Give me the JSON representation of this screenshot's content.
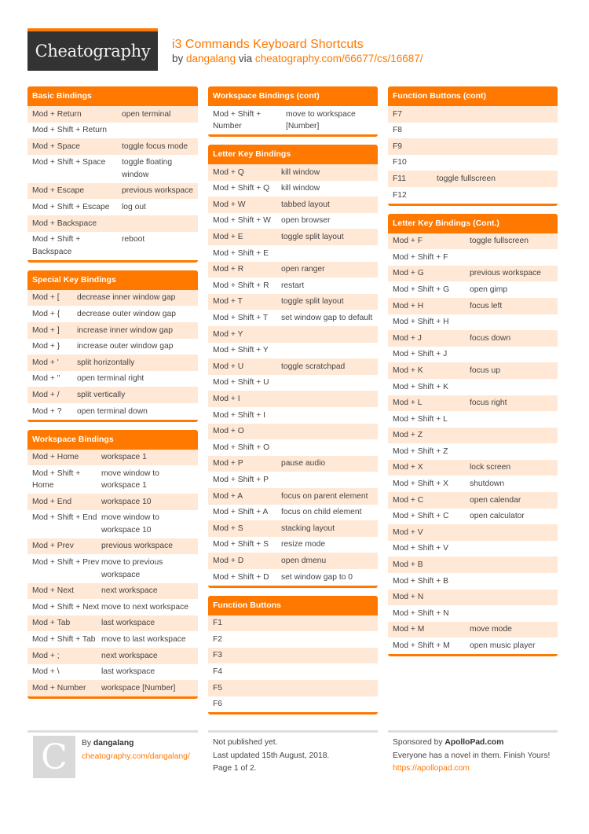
{
  "header": {
    "logo": "Cheatography",
    "title": "i3 Commands Keyboard Shortcuts",
    "by": "by",
    "author": "dangalang",
    "via": "via",
    "url": "cheatography.com/66677/cs/16687/"
  },
  "sections": {
    "basic": {
      "title": "Basic Bindings",
      "rows": [
        {
          "key": "Mod + Return",
          "action": "open terminal"
        },
        {
          "key": "Mod + Shift + Return",
          "action": ""
        },
        {
          "key": "Mod + Space",
          "action": "toggle focus mode"
        },
        {
          "key": "Mod + Shift + Space",
          "action": "toggle floating window"
        },
        {
          "key": "Mod + Escape",
          "action": "previous workspace"
        },
        {
          "key": "Mod + Shift + Escape",
          "action": "log out"
        },
        {
          "key": "Mod + Backspace",
          "action": ""
        },
        {
          "key": "Mod + Shift + Backspace",
          "action": "reboot"
        }
      ]
    },
    "special": {
      "title": "Special Key Bindings",
      "rows": [
        {
          "key": "Mod + [",
          "action": "decrease inner window gap"
        },
        {
          "key": "Mod + {",
          "action": "decrease outer window gap"
        },
        {
          "key": "Mod + ]",
          "action": "increase inner window gap"
        },
        {
          "key": "Mod + }",
          "action": "increase outer window gap"
        },
        {
          "key": "Mod + '",
          "action": "split horizontally"
        },
        {
          "key": "Mod + \"",
          "action": "open terminal right"
        },
        {
          "key": "Mod + /",
          "action": "split vertically"
        },
        {
          "key": "Mod + ?",
          "action": "open terminal down"
        }
      ]
    },
    "workspace": {
      "title": "Workspace Bindings",
      "rows": [
        {
          "key": "Mod + Home",
          "action": "workspace 1"
        },
        {
          "key": "Mod + Shift + Home",
          "action": "move window to workspace 1"
        },
        {
          "key": "Mod + End",
          "action": "workspace 10"
        },
        {
          "key": "Mod + Shift + End",
          "action": "move window to workspace 10"
        },
        {
          "key": "Mod + Prev",
          "action": "previous workspace"
        },
        {
          "key": "Mod + Shift + Prev",
          "action": "move to previous workspace"
        },
        {
          "key": "Mod + Next",
          "action": "next workspace"
        },
        {
          "key": "Mod + Shift + Next",
          "action": "move to next workspace"
        },
        {
          "key": "Mod + Tab",
          "action": "last workspace"
        },
        {
          "key": "Mod + Shift + Tab",
          "action": "move to last workspace"
        },
        {
          "key": "Mod + ;",
          "action": "next workspace"
        },
        {
          "key": "Mod + \\",
          "action": "last workspace"
        },
        {
          "key": "Mod + Number",
          "action": "workspace [Number]"
        }
      ]
    },
    "workspace_cont": {
      "title": "Workspace Bindings (cont)",
      "rows": [
        {
          "key": "Mod + Shift + Number",
          "action": "move to workspace [Number]"
        }
      ]
    },
    "letter": {
      "title": "Letter Key Bindings",
      "rows": [
        {
          "key": "Mod + Q",
          "action": "kill window"
        },
        {
          "key": "Mod + Shift + Q",
          "action": "kill window"
        },
        {
          "key": "Mod + W",
          "action": "tabbed layout"
        },
        {
          "key": "Mod + Shift + W",
          "action": "open browser"
        },
        {
          "key": "Mod + E",
          "action": "toggle split layout"
        },
        {
          "key": "Mod + Shift + E",
          "action": ""
        },
        {
          "key": "Mod + R",
          "action": "open ranger"
        },
        {
          "key": "Mod + Shift + R",
          "action": "restart"
        },
        {
          "key": "Mod + T",
          "action": "toggle split layout"
        },
        {
          "key": "Mod + Shift + T",
          "action": "set window gap to default"
        },
        {
          "key": "Mod + Y",
          "action": ""
        },
        {
          "key": "Mod + Shift + Y",
          "action": ""
        },
        {
          "key": "Mod + U",
          "action": "toggle scratchpad"
        },
        {
          "key": "Mod + Shift + U",
          "action": ""
        },
        {
          "key": "Mod + I",
          "action": ""
        },
        {
          "key": "Mod + Shift + I",
          "action": ""
        },
        {
          "key": "Mod + O",
          "action": ""
        },
        {
          "key": "Mod + Shift + O",
          "action": ""
        },
        {
          "key": "Mod + P",
          "action": "pause audio"
        },
        {
          "key": "Mod + Shift + P",
          "action": ""
        },
        {
          "key": "Mod + A",
          "action": "focus on parent element"
        },
        {
          "key": "Mod + Shift + A",
          "action": "focus on child element"
        },
        {
          "key": "Mod + S",
          "action": "stacking layout"
        },
        {
          "key": "Mod + Shift + S",
          "action": "resize mode"
        },
        {
          "key": "Mod + D",
          "action": "open dmenu"
        },
        {
          "key": "Mod + Shift + D",
          "action": "set window gap to 0"
        }
      ]
    },
    "function": {
      "title": "Function Buttons",
      "rows": [
        {
          "key": "F1",
          "action": ""
        },
        {
          "key": "F2",
          "action": ""
        },
        {
          "key": "F3",
          "action": ""
        },
        {
          "key": "F4",
          "action": ""
        },
        {
          "key": "F5",
          "action": ""
        },
        {
          "key": "F6",
          "action": ""
        }
      ]
    },
    "function_cont": {
      "title": "Function Buttons (cont)",
      "rows": [
        {
          "key": "F7",
          "action": ""
        },
        {
          "key": "F8",
          "action": ""
        },
        {
          "key": "F9",
          "action": ""
        },
        {
          "key": "F10",
          "action": ""
        },
        {
          "key": "F11",
          "action": "toggle fullscreen"
        },
        {
          "key": "F12",
          "action": ""
        }
      ]
    },
    "letter_cont": {
      "title": "Letter Key Bindings (Cont.)",
      "rows": [
        {
          "key": "Mod + F",
          "action": "toggle fullscreen"
        },
        {
          "key": "Mod + Shift + F",
          "action": ""
        },
        {
          "key": "Mod + G",
          "action": "previous workspace"
        },
        {
          "key": "Mod + Shift + G",
          "action": "open gimp"
        },
        {
          "key": "Mod + H",
          "action": "focus left"
        },
        {
          "key": "Mod + Shift + H",
          "action": ""
        },
        {
          "key": "Mod + J",
          "action": "focus down"
        },
        {
          "key": "Mod + Shift + J",
          "action": ""
        },
        {
          "key": "Mod + K",
          "action": "focus up"
        },
        {
          "key": "Mod + Shift + K",
          "action": ""
        },
        {
          "key": "Mod + L",
          "action": "focus right"
        },
        {
          "key": "Mod + Shift + L",
          "action": ""
        },
        {
          "key": "Mod + Z",
          "action": ""
        },
        {
          "key": "Mod + Shift + Z",
          "action": ""
        },
        {
          "key": "Mod + X",
          "action": "lock screen"
        },
        {
          "key": "Mod + Shift + X",
          "action": "shutdown"
        },
        {
          "key": "Mod + C",
          "action": "open calendar"
        },
        {
          "key": "Mod + Shift + C",
          "action": "open calculator"
        },
        {
          "key": "Mod + V",
          "action": ""
        },
        {
          "key": "Mod + Shift + V",
          "action": ""
        },
        {
          "key": "Mod + B",
          "action": ""
        },
        {
          "key": "Mod + Shift + B",
          "action": ""
        },
        {
          "key": "Mod + N",
          "action": ""
        },
        {
          "key": "Mod + Shift + N",
          "action": ""
        },
        {
          "key": "Mod + M",
          "action": "move mode"
        },
        {
          "key": "Mod + Shift + M",
          "action": "open music player"
        }
      ]
    }
  },
  "footer": {
    "avatar_letter": "C",
    "by_label": "By",
    "author": "dangalang",
    "author_url": "cheatography.com/dangalang/",
    "status": "Not published yet.",
    "updated": "Last updated 15th August, 2018.",
    "page": "Page 1 of 2.",
    "sponsored_label": "Sponsored by",
    "sponsor": "ApolloPad.com",
    "sponsor_tagline": "Everyone has a novel in them. Finish Yours!",
    "sponsor_url": "https://apollopad.com"
  },
  "colors": {
    "accent": "#ff7800",
    "row_alt": "#ffe8d6",
    "logo_bg": "#333333"
  }
}
